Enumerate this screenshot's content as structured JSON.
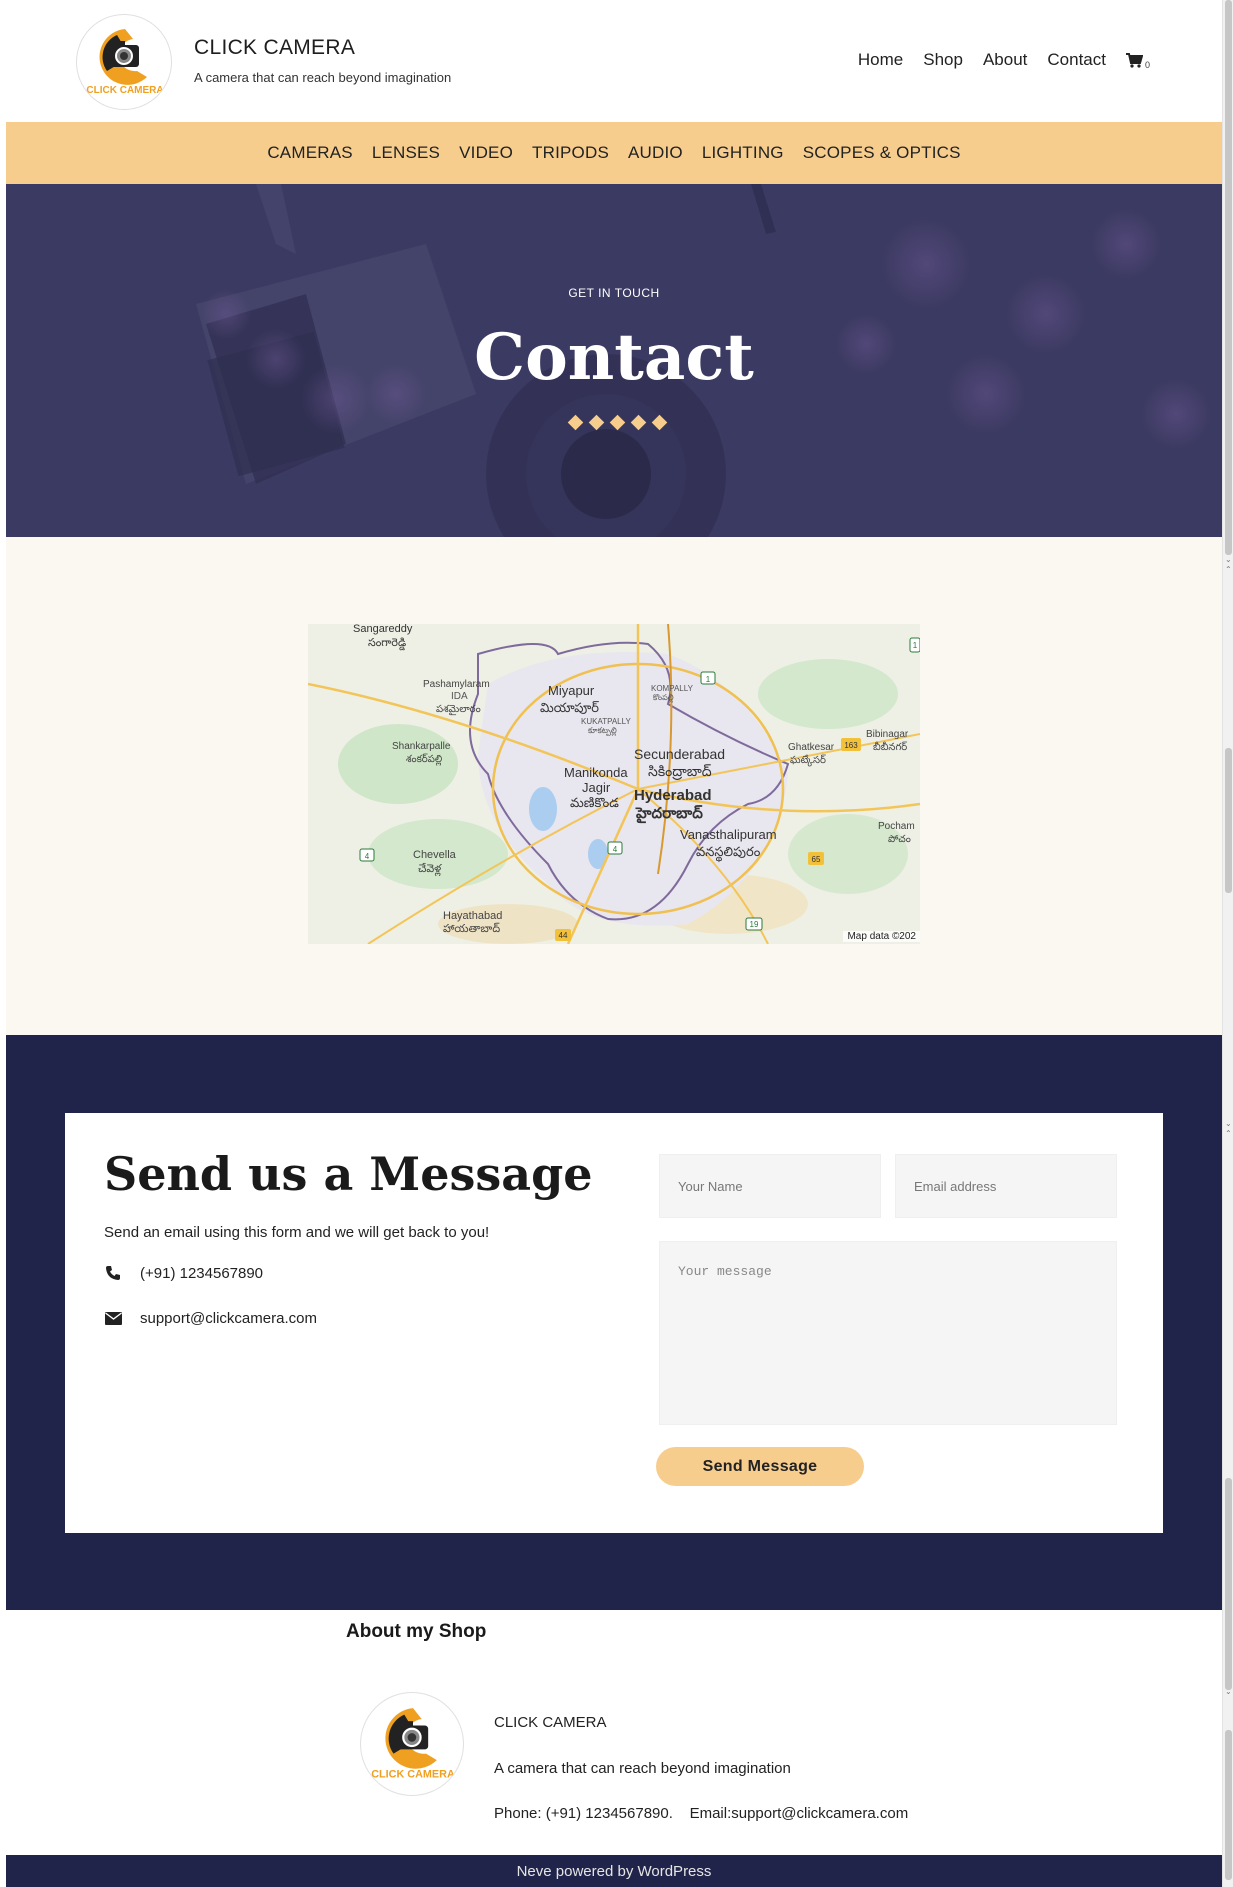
{
  "header": {
    "site_title": "CLICK CAMERA",
    "tagline": "A camera that can reach beyond imagination",
    "logo_text": "CLICK CAMERA",
    "nav": [
      "Home",
      "Shop",
      "About",
      "Contact"
    ],
    "cart_count": "0"
  },
  "categories": [
    "CAMERAS",
    "LENSES",
    "VIDEO",
    "TRIPODS",
    "AUDIO",
    "LIGHTING",
    "SCOPES & OPTICS"
  ],
  "hero": {
    "eyebrow": "GET IN TOUCH",
    "title": "Contact"
  },
  "map": {
    "labels": {
      "sangareddy": "Sangareddy",
      "sangareddy_te": "సంగారెడ్డి",
      "pashamylaram": "Pashamylaram",
      "ida": "IDA",
      "pashamylaram_te": "పశమైలారం",
      "miyapur": "Miyapur",
      "miyapur_te": "మియాపూర్",
      "kompally": "KOMPALLY",
      "kompally_te": "కొంపల్లి",
      "kukatpally": "KUKATPALLY",
      "kukatpally_te": "కూకట్పల్లి",
      "shankarpalle": "Shankarpalle",
      "shankarpalle_te": "శంకర్‌పల్లి",
      "secunderabad": "Secunderabad",
      "secunderabad_te": "సికింద్రాబాద్",
      "manikonda": "Manikonda",
      "jagir": "Jagir",
      "manikonda_te": "మణికొండ",
      "hyderabad": "Hyderabad",
      "hyderabad_te": "హైదరాబాద్",
      "ghatkesar": "Ghatkesar",
      "ghatkesar_te": "ఘట్కేసర్",
      "bibinagar": "Bibinagar",
      "bibinagar_te": "బీబీనగర్",
      "vanasthalipuram": "Vanasthalipuram",
      "vanasthalipuram_te": "వనస్థలిపురం",
      "pocham": "Pocham",
      "pocham_te": "పోచం",
      "chevella": "Chevella",
      "chevella_te": "చేవెళ్ల",
      "hayathabad": "Hayathabad",
      "hayathabad_te": "హాయతాబాద్"
    },
    "shields": [
      "1",
      "163",
      "4",
      "65",
      "4",
      "44",
      "19",
      "1"
    ],
    "credit": "Map data ©202"
  },
  "contact": {
    "title": "Send us a Message",
    "description": "Send an email using this form and we will get back to you!",
    "phone": "(+91) 1234567890",
    "email": "support@clickcamera.com",
    "name_placeholder": "Your Name",
    "email_placeholder": "Email address",
    "message_placeholder": "Your message",
    "send_label": "Send Message"
  },
  "footer": {
    "about_heading": "About my Shop",
    "shop_name": "CLICK CAMERA",
    "tagline": "A camera that can reach beyond imagination",
    "contact_line": "Phone: (+91) 1234567890.    Email:support@clickcamera.com",
    "credit": "Neve powered by WordPress"
  },
  "colors": {
    "accent": "#f7cd8e",
    "navy": "#21244a",
    "hero_overlay": "#3f3d66",
    "cream": "#fbf8f1"
  }
}
